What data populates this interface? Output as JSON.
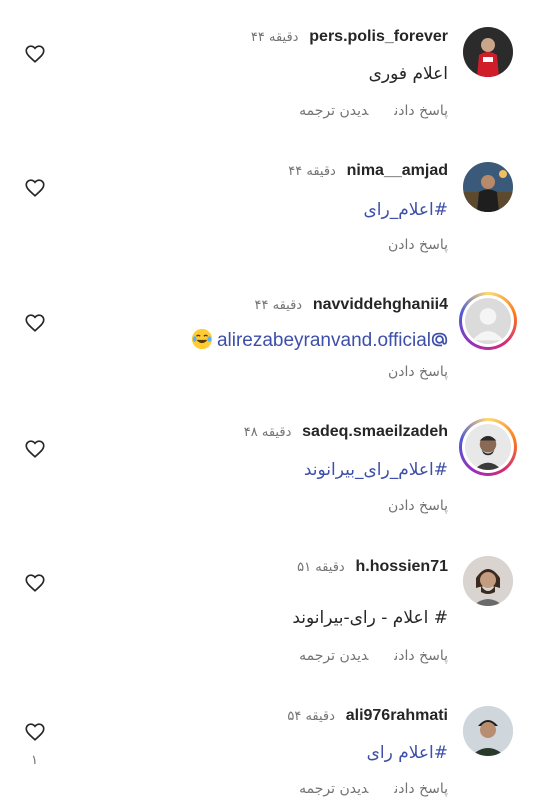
{
  "comments": [
    {
      "username": "pers.polis_forever",
      "time": "۴۴ دقیقه",
      "text": "اعلام فوری",
      "reply_label": "پاسخ دادن",
      "translate_label": "دیدن ترجمه"
    },
    {
      "username": "nima__amjad",
      "time": "۴۴ دقیقه",
      "text": "#اعلام_رای",
      "reply_label": "پاسخ دادن"
    },
    {
      "username": "navviddehghanii4",
      "time": "۴۴ دقیقه",
      "text": "alirezabeyranvand.official",
      "reply_label": "پاسخ دادن"
    },
    {
      "username": "sadeq.smaeilzadeh",
      "time": "۴۸ دقیقه",
      "text": "#اعلام_رای_بیرانوند",
      "reply_label": "پاسخ دادن"
    },
    {
      "username": "h.hossien71",
      "time": "۵۱ دقیقه",
      "text": "# اعلام - رای-بیرانوند",
      "reply_label": "پاسخ دادن",
      "translate_label": "دیدن ترجمه"
    },
    {
      "username": "ali976rahmati",
      "time": "۵۴ دقیقه",
      "text": "#اعلام رای",
      "reply_label": "پاسخ دادن",
      "translate_label": "دیدن ترجمه",
      "like_count": "۱"
    }
  ],
  "icons": {
    "like": "heart-outline-icon",
    "mention": "at-sign-icon",
    "emoji": "face-with-tears-of-joy-emoji"
  },
  "colors": {
    "hashtag": "#3d4fa8",
    "muted": "#737373",
    "text": "#262626"
  }
}
